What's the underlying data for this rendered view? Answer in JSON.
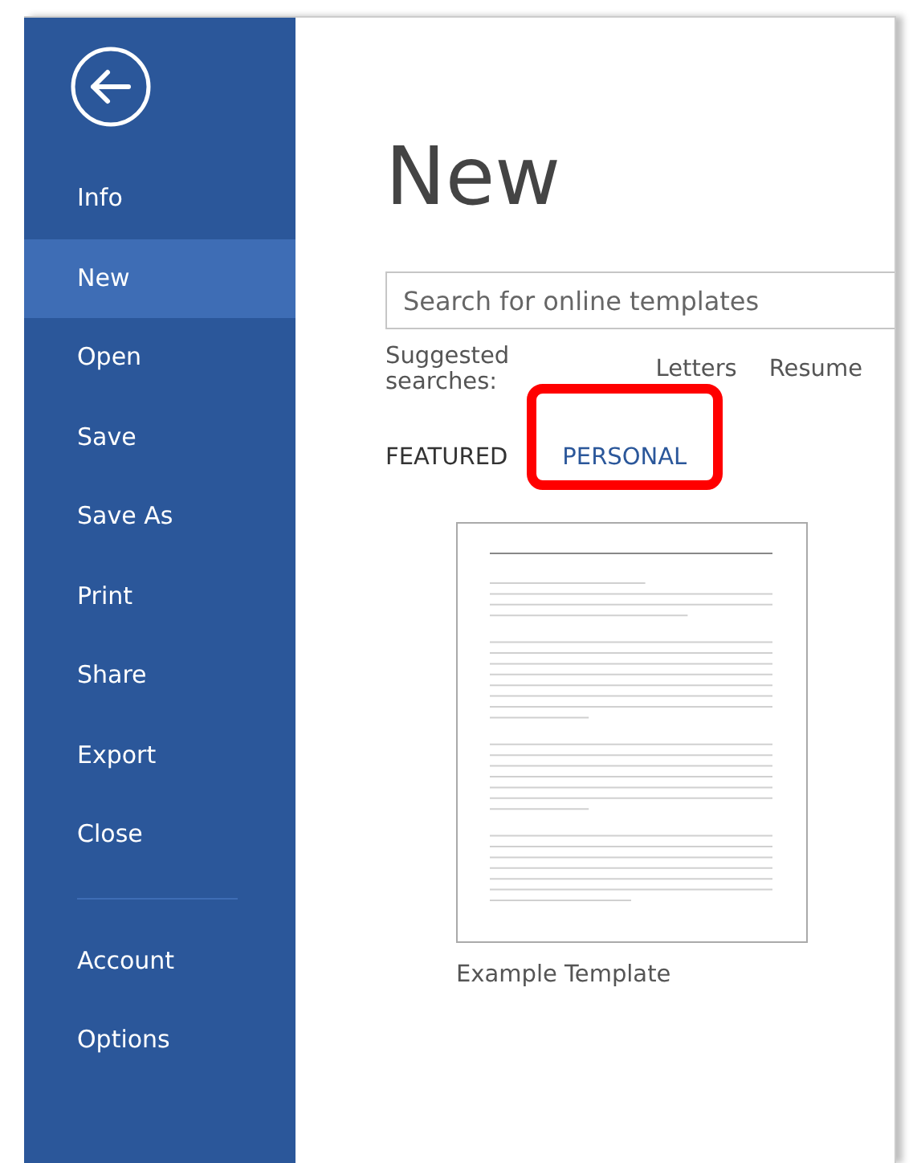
{
  "sidebar": {
    "items": [
      {
        "label": "Info",
        "selected": false
      },
      {
        "label": "New",
        "selected": true
      },
      {
        "label": "Open",
        "selected": false
      },
      {
        "label": "Save",
        "selected": false
      },
      {
        "label": "Save As",
        "selected": false
      },
      {
        "label": "Print",
        "selected": false
      },
      {
        "label": "Share",
        "selected": false
      },
      {
        "label": "Export",
        "selected": false
      },
      {
        "label": "Close",
        "selected": false
      }
    ],
    "bottom_items": [
      {
        "label": "Account",
        "selected": false
      },
      {
        "label": "Options",
        "selected": false
      }
    ]
  },
  "main": {
    "title": "New",
    "search": {
      "placeholder": "Search for online templates"
    },
    "suggested": {
      "label": "Suggested searches:",
      "links": [
        "Letters",
        "Resume"
      ]
    },
    "tabs": [
      {
        "label": "FEATURED",
        "selected": false,
        "highlighted": false
      },
      {
        "label": "PERSONAL",
        "selected": true,
        "highlighted": true
      }
    ],
    "templates": [
      {
        "name": "Example Template"
      }
    ]
  }
}
